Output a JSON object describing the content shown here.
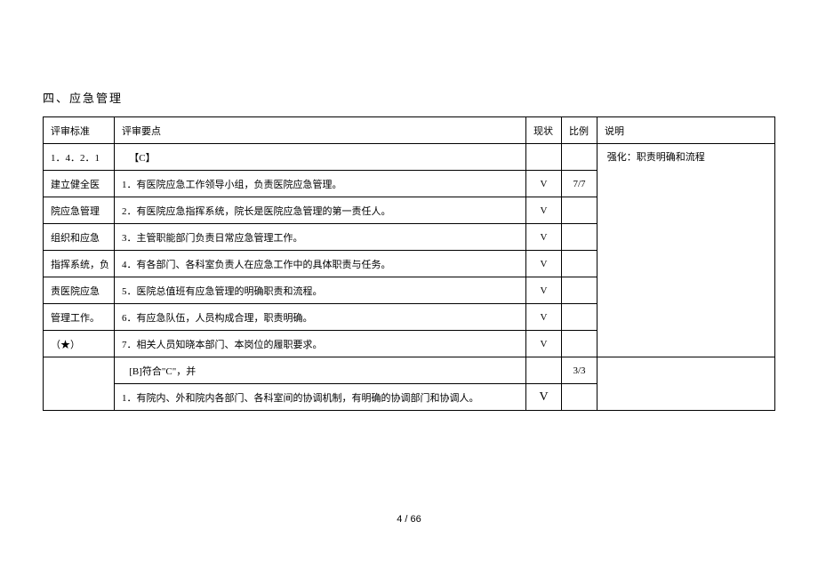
{
  "section_title": "四、应急管理",
  "headers": {
    "criteria": "评审标准",
    "points": "评审要点",
    "status": "现状",
    "ratio": "比例",
    "note": "说明"
  },
  "criteria": {
    "code": "1．4．2．1",
    "lines": [
      "建立健全医",
      "院应急管理",
      "组织和应急",
      "指挥系统，负",
      "责医院应急",
      "管理工作。",
      "（★）"
    ]
  },
  "section_c": {
    "label": "【C】",
    "ratio": "7/7",
    "note": "强化：职责明确和流程",
    "items": [
      {
        "text": "1．有医院应急工作领导小组，负责医院应急管理。",
        "status": "V"
      },
      {
        "text": "2．有医院应急指挥系统，院长是医院应急管理的第一责任人。",
        "status": "V"
      },
      {
        "text": "3．主管职能部门负责日常应急管理工作。",
        "status": "V"
      },
      {
        "text": "4．有各部门、各科室负责人在应急工作中的具体职责与任务。",
        "status": "V"
      },
      {
        "text": "5．医院总值班有应急管理的明确职责和流程。",
        "status": "V"
      },
      {
        "text": "6．有应急队伍，人员构成合理，职责明确。",
        "status": "V"
      },
      {
        "text": "7．相关人员知晓本部门、本岗位的履职要求。",
        "status": "V"
      }
    ]
  },
  "section_b": {
    "label": "[B]符合\"C\"，并",
    "ratio": "3/3",
    "items": [
      {
        "text": "1．有院内、外和院内各部门、各科室间的协调机制，有明确的协调部门和协调人。",
        "status": "V"
      }
    ]
  },
  "footer": "4 / 66"
}
